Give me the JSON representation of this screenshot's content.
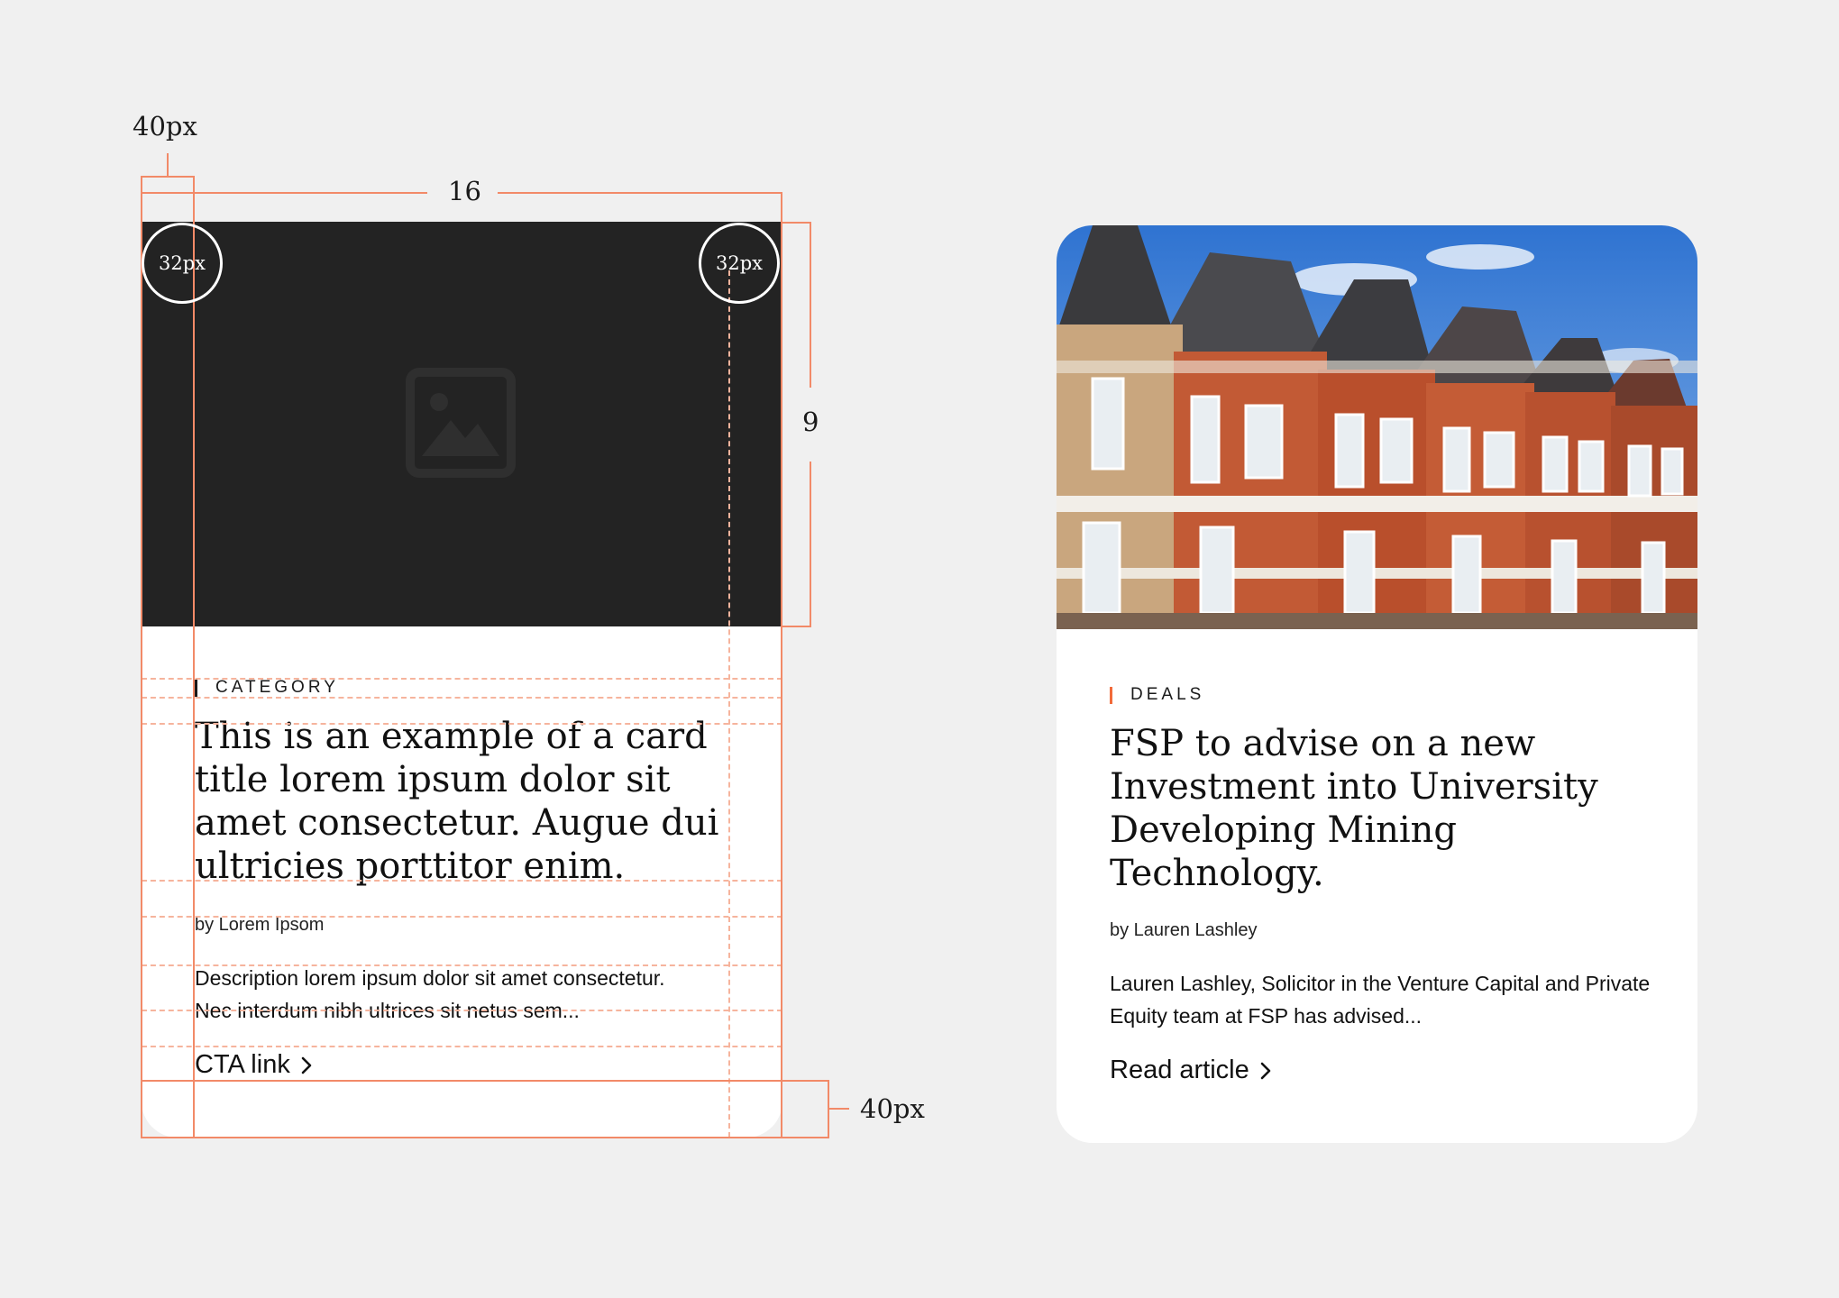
{
  "annotations": {
    "padding_top_label": "40px",
    "aspect_width_label": "16",
    "aspect_height_label": "9",
    "radius_left_label": "32px",
    "radius_right_label": "32px",
    "padding_bottom_label": "40px"
  },
  "template_card": {
    "image_icon": "image-placeholder-icon",
    "category": "CATEGORY",
    "title": "This is an example of a card title lorem ipsum dolor sit amet consectetur. Augue dui ultricies porttitor enim.",
    "author": "by Lorem Ipsom",
    "description": "Description lorem ipsum dolor sit amet consectetur. Nec interdum nibh ultrices sit netus sem...",
    "cta": "CTA link",
    "cta_icon": "chevron-right-icon"
  },
  "article_card": {
    "image_icon": "terraced-houses-photo",
    "category": "DEALS",
    "title": "FSP to advise on a new Investment into University Developing Mining Technology.",
    "author": "by Lauren Lashley",
    "description": "Lauren Lashley, Solicitor in the Venture Capital and Private Equity team at FSP has advised...",
    "cta": "Read article",
    "cta_icon": "chevron-right-icon"
  },
  "colors": {
    "background": "#f0f0f0",
    "card": "#ffffff",
    "placeholder": "#232323",
    "annotation": "#f28a68",
    "category_accent_template": "#1a1a1a",
    "category_accent_article": "#f26b3a",
    "text": "#111111"
  }
}
